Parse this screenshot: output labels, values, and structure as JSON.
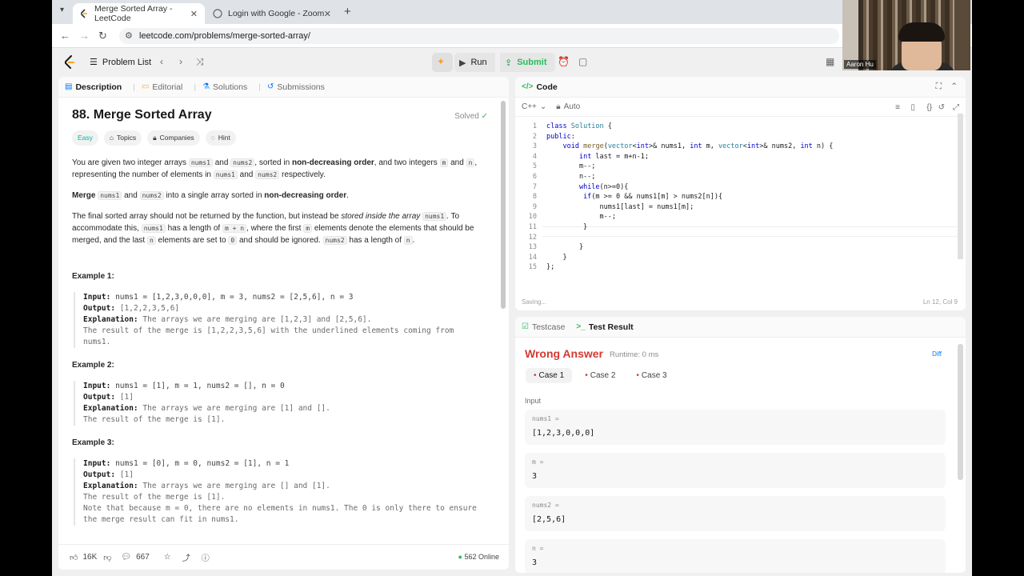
{
  "browser": {
    "tabs": [
      {
        "title": "Merge Sorted Array - LeetCode",
        "active": true
      },
      {
        "title": "Login with Google - Zoom",
        "active": false
      }
    ],
    "url": "leetcode.com/problems/merge-sorted-array/"
  },
  "topbar": {
    "problem_list": "Problem List",
    "run": "Run",
    "submit": "Submit"
  },
  "left_tabs": [
    "Description",
    "Editorial",
    "Solutions",
    "Submissions"
  ],
  "problem": {
    "title": "88. Merge Sorted Array",
    "solved": "Solved",
    "tags": [
      "Easy",
      "Topics",
      "Companies",
      "Hint"
    ],
    "p1": {
      "a": "You are given two integer arrays ",
      "c1": "nums1",
      "b": " and ",
      "c2": "nums2",
      "c": ", sorted in ",
      "bold": "non-decreasing order",
      "d": ", and two integers ",
      "c3": "m",
      "e": " and ",
      "c4": "n",
      "f": ", representing the number of elements in ",
      "c5": "nums1",
      "g": " and ",
      "c6": "nums2",
      "h": " respectively."
    },
    "p2": {
      "bold1": "Merge",
      "c1": "nums1",
      "a": " and ",
      "c2": "nums2",
      "b": " into a single array sorted in ",
      "bold2": "non-decreasing order",
      "c": "."
    },
    "p3": {
      "a": "The final sorted array should not be returned by the function, but instead be ",
      "em": "stored inside the array",
      "c1": "nums1",
      "b": ". To accommodate this, ",
      "c2": "nums1",
      "c": " has a length of ",
      "c3": "m + n",
      "d": ", where the first ",
      "c4": "m",
      "e": " elements denote the elements that should be merged, and the last ",
      "c5": "n",
      "f": " elements are set to ",
      "c6": "0",
      "g": " and should be ignored. ",
      "c7": "nums2",
      "h": " has a length of ",
      "c8": "n",
      "i": "."
    },
    "examples": [
      {
        "heading": "Example 1:",
        "input": "nums1 = [1,2,3,0,0,0], m = 3, nums2 = [2,5,6], n = 3",
        "output": "[1,2,2,3,5,6]",
        "explanation": [
          "The arrays we are merging are [1,2,3] and [2,5,6].",
          "The result of the merge is [1,2,2,3,5,6] with the underlined elements coming from",
          "nums1."
        ]
      },
      {
        "heading": "Example 2:",
        "input": "nums1 = [1], m = 1, nums2 = [], n = 0",
        "output": "[1]",
        "explanation": [
          "The arrays we are merging are [1] and [].",
          "The result of the merge is [1]."
        ]
      },
      {
        "heading": "Example 3:",
        "input": "nums1 = [0], m = 0, nums2 = [1], n = 1",
        "output": "[1]",
        "explanation": [
          "The arrays we are merging are [] and [1].",
          "The result of the merge is [1].",
          "Note that because m = 0, there are no elements in nums1. The 0 is only there to ensure",
          "the merge result can fit in nums1."
        ]
      }
    ],
    "labels": {
      "input": "Input:",
      "output": "Output:",
      "explanation": "Explanation:"
    },
    "footer": {
      "likes": "16K",
      "comments": "667",
      "online": "562 Online"
    }
  },
  "code": {
    "tab": "Code",
    "language": "C++",
    "mode": "Auto",
    "lines": [
      "class Solution {",
      "public:",
      "    void merge(vector<int>& nums1, int m, vector<int>& nums2, int n) {",
      "        int last = m+n-1;",
      "        m--;",
      "        n--;",
      "        while(n>=0){",
      "         if(m >= 0 && nums1[m] > nums2[n]){",
      "             nums1[last] = nums1[m];",
      "             m--;",
      "         }",
      "",
      "        }",
      "    }",
      "};"
    ],
    "status": "Saving...",
    "position": "Ln 12, Col 9"
  },
  "result": {
    "tabs": [
      "Testcase",
      "Test Result"
    ],
    "verdict": "Wrong Answer",
    "runtime": "Runtime: 0 ms",
    "diff": "Diff",
    "cases": [
      "Case 1",
      "Case 2",
      "Case 3"
    ],
    "input_label": "Input",
    "vars": [
      {
        "name": "nums1 =",
        "value": "[1,2,3,0,0,0]"
      },
      {
        "name": "m =",
        "value": "3"
      },
      {
        "name": "nums2 =",
        "value": "[2,5,6]"
      },
      {
        "name": "n =",
        "value": "3"
      }
    ]
  },
  "webcam": {
    "name": "Aaron Hu"
  },
  "colors": {
    "accent_green": "#2cbb5d",
    "error_red": "#d33a32",
    "easy": "#00b8a3"
  }
}
